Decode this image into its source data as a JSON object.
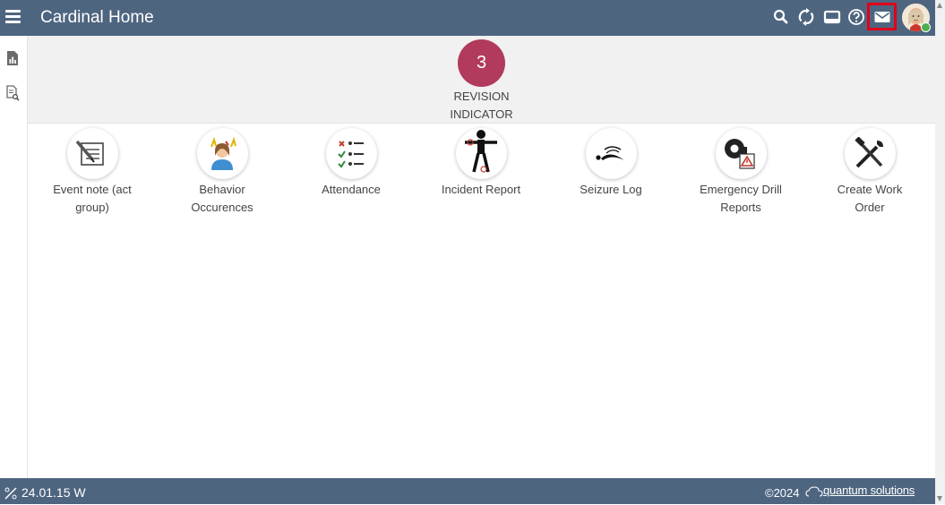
{
  "app": {
    "title": "Cardinal Home"
  },
  "header_icons": [
    "menu-icon",
    "search-icon",
    "refresh-icon",
    "display-icon",
    "help-icon",
    "mail-icon"
  ],
  "banner": {
    "revision_count": "3",
    "revision_label_line1": "REVISION",
    "revision_label_line2": "INDICATOR",
    "accent_color": "#b23a5d"
  },
  "tiles": [
    {
      "line1": "Event note (act",
      "line2": "group)"
    },
    {
      "line1": "Behavior",
      "line2": "Occurences"
    },
    {
      "line1": "Attendance",
      "line2": ""
    },
    {
      "line1": "Incident Report",
      "line2": ""
    },
    {
      "line1": "Seizure Log",
      "line2": ""
    },
    {
      "line1": "Emergency Drill",
      "line2": "Reports"
    },
    {
      "line1": "Create Work",
      "line2": "Order"
    }
  ],
  "footer": {
    "version": "24.01.15 W",
    "copyright": "©2024",
    "brand": "quantum solutions"
  },
  "colors": {
    "header_bg": "#4e6580",
    "highlight": "#e0001b"
  }
}
